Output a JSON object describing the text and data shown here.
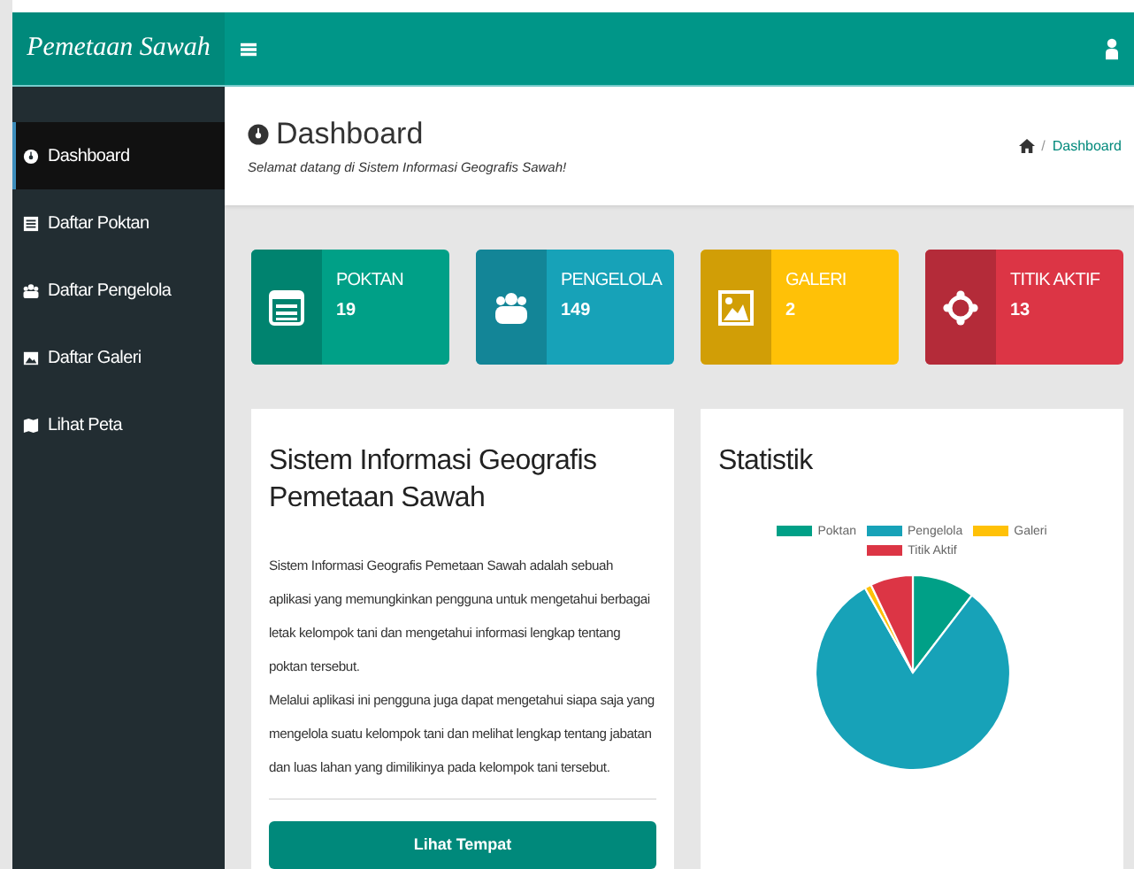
{
  "brand": "Pemetaan Sawah",
  "sidebar": {
    "items": [
      {
        "label": "Dashboard",
        "kind": "dashboard",
        "selected": true
      },
      {
        "label": "Daftar Poktan",
        "kind": "list",
        "selected": false
      },
      {
        "label": "Daftar Pengelola",
        "kind": "users",
        "selected": false
      },
      {
        "label": "Daftar Galeri",
        "kind": "image",
        "selected": false
      },
      {
        "label": "Lihat Peta",
        "kind": "map",
        "selected": false
      }
    ]
  },
  "page_header": {
    "title": "Dashboard",
    "subtitle": "Selamat datang di Sistem Informasi Geografis Sawah!",
    "breadcrumb": {
      "separator": "/",
      "items": [
        "Dashboard"
      ]
    }
  },
  "stat_cards": [
    {
      "label": "POKTAN",
      "value": "19",
      "kind": "list",
      "color": "#00a087"
    },
    {
      "label": "PENGELOLA",
      "value": "149",
      "kind": "users",
      "color": "#17a2b8"
    },
    {
      "label": "GALERI",
      "value": "2",
      "kind": "image",
      "color": "#ffc107"
    },
    {
      "label": "TITIK AKTIF",
      "value": "13",
      "kind": "target",
      "color": "#dc3545"
    }
  ],
  "info_panel": {
    "title": "Sistem Informasi Geografis Pemetaan Sawah",
    "paragraphs": [
      "Sistem Informasi Geografis Pemetaan Sawah adalah sebuah aplikasi yang memungkinkan pengguna untuk mengetahui berbagai letak kelompok tani dan mengetahui informasi lengkap tentang poktan tersebut.",
      "Melalui aplikasi ini pengguna juga dapat mengetahui siapa saja yang mengelola suatu kelompok tani dan melihat lengkap tentang jabatan dan luas lahan yang dimilikinya pada kelompok tani tersebut."
    ],
    "button": "Lihat Tempat"
  },
  "stats_panel": {
    "title": "Statistik",
    "chart_data": {
      "type": "pie",
      "categories": [
        "Poktan",
        "Pengelola",
        "Galeri",
        "Titik Aktif"
      ],
      "legend": "top",
      "series": [
        {
          "values": [
            10.4,
            81.4,
            1.1,
            7.1
          ],
          "colors": [
            "#00a087",
            "#17a2b8",
            "#ffc107",
            "#dc3545"
          ]
        }
      ]
    }
  }
}
